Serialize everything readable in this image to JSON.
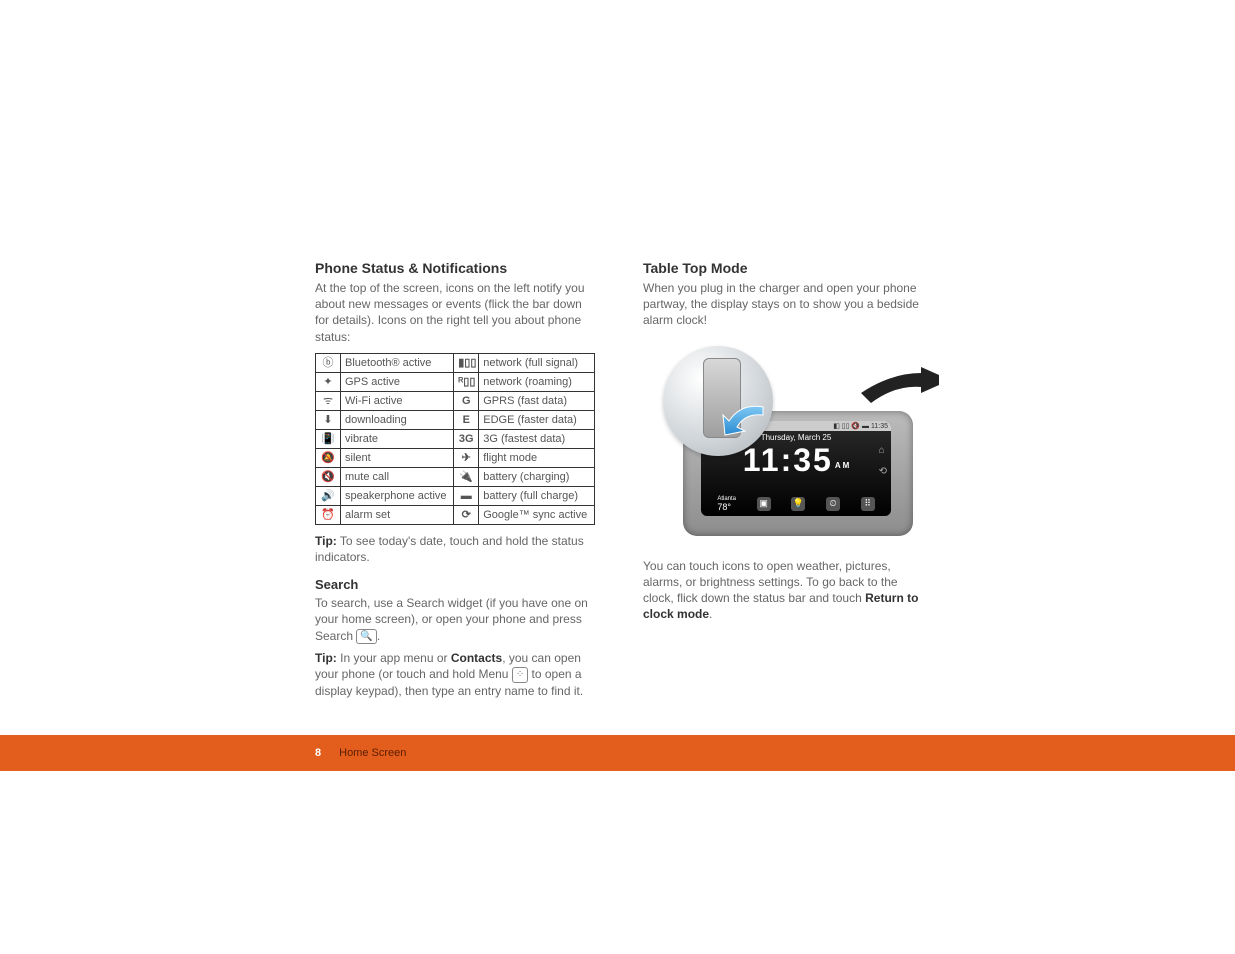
{
  "left": {
    "h_status": "Phone Status & Notifications",
    "p_status": "At the top of the screen, icons on the left notify you about new messages or events (flick the bar down for details). Icons on the right tell you about phone status:",
    "table": [
      {
        "li": "bluetooth",
        "lg": "ⓑ",
        "lt": "Bluetooth® active",
        "ri": "signal-full",
        "rg": "▮▯▯",
        "rt": "network (full signal)"
      },
      {
        "li": "gps",
        "lg": "✦",
        "lt": "GPS active",
        "ri": "signal-roaming",
        "rg": "ᴿ▯▯",
        "rt": "network (roaming)"
      },
      {
        "li": "wifi",
        "lg": "ᯤ",
        "lt": "Wi-Fi active",
        "ri": "gprs",
        "rg": "G",
        "rt": "GPRS (fast data)"
      },
      {
        "li": "download",
        "lg": "⬇",
        "lt": "downloading",
        "ri": "edge",
        "rg": "E",
        "rt": "EDGE (faster data)"
      },
      {
        "li": "vibrate",
        "lg": "📳",
        "lt": "vibrate",
        "ri": "3g",
        "rg": "3G",
        "rt": "3G (fastest data)"
      },
      {
        "li": "silent",
        "lg": "🔕",
        "lt": "silent",
        "ri": "flight",
        "rg": "✈",
        "rt": "flight mode"
      },
      {
        "li": "mute",
        "lg": "🔇",
        "lt": "mute call",
        "ri": "batt-charging",
        "rg": "🔌",
        "rt": "battery (charging)"
      },
      {
        "li": "speakerphone",
        "lg": "🔊",
        "lt": "speakerphone active",
        "ri": "batt-full",
        "rg": "▬",
        "rt": "battery (full charge)"
      },
      {
        "li": "alarm",
        "lg": "⏰",
        "lt": "alarm set",
        "ri": "sync",
        "rg": "⟳",
        "rt": "Google™ sync active"
      }
    ],
    "tip1_label": "Tip:",
    "tip1": " To see today's date, touch and hold the status indicators.",
    "h_search": "Search",
    "p_search_a": "To search, use a Search widget (if you have one on your home screen), or open your phone and press Search ",
    "search_icon_glyph": "🔍",
    "p_search_b": ".",
    "tip2_label": "Tip:",
    "tip2_a": " In your app menu or ",
    "tip2_contacts": "Contacts",
    "tip2_b": ", you can open your phone (or touch and hold Menu ",
    "menu_icon_glyph": "⁘",
    "tip2_c": " to open a display keypad), then type an entry name to find it."
  },
  "right": {
    "h_ttm": "Table Top Mode",
    "p_ttm": "When you plug in the charger and open your phone partway, the display stays on to show you a bedside alarm clock!",
    "phone": {
      "statusbar": "◧ ▯▯ 🔇 ▬ 11:35",
      "date": "Thursday, March 25",
      "time": "11:35",
      "ampm": "AM",
      "city": "Atlanta",
      "temp": "78°"
    },
    "p_after_a": "You can touch icons to open weather, pictures, alarms, or brightness settings. To go back to the clock, flick down the status bar and touch ",
    "p_after_bold": "Return to clock mode",
    "p_after_b": "."
  },
  "footer": {
    "page": "8",
    "section": "Home Screen"
  }
}
